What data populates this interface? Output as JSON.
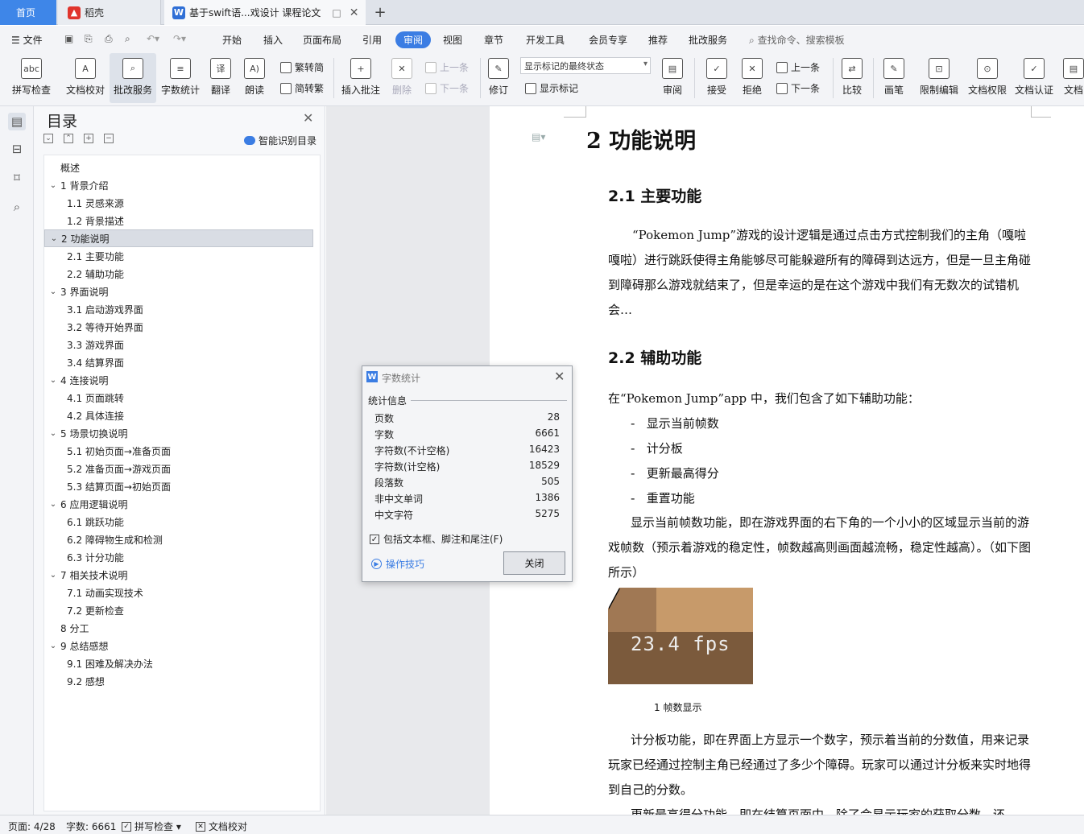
{
  "tabs": {
    "home": "首页",
    "daoke": "稻壳",
    "doc": "基于swift语...戏设计 课程论文",
    "add": "+"
  },
  "menu": {
    "file": "文件",
    "items": [
      "开始",
      "插入",
      "页面布局",
      "引用",
      "审阅",
      "视图",
      "章节",
      "开发工具",
      "会员专享",
      "推荐",
      "批改服务"
    ],
    "active": "审阅",
    "search": "查找命令、搜索模板"
  },
  "ribbon": {
    "spell": "拼写检查",
    "doc_check": "文档校对",
    "correction": "批改服务",
    "word_count": "字数统计",
    "translate": "翻译",
    "read": "朗读",
    "trad": "繁转简",
    "simp": "简转繁",
    "insert_comment": "插入批注",
    "delete": "删除",
    "prev": "上一条",
    "next": "下一条",
    "revise": "修订",
    "markup_state": "显示标记的最终状态",
    "show_markup": "显示标记",
    "review": "审阅",
    "accept": "接受",
    "reject": "拒绝",
    "prev2": "上一条",
    "next2": "下一条",
    "compare": "比较",
    "pen": "画笔",
    "restrict": "限制编辑",
    "permission": "文档权限",
    "certify": "文档认证",
    "more": "文档"
  },
  "toc": {
    "title": "目录",
    "smart": "智能识别目录",
    "items": [
      {
        "label": "概述",
        "level": 0,
        "caret": ""
      },
      {
        "label": "1  背景介绍",
        "level": 0,
        "caret": "v"
      },
      {
        "label": "1.1 灵感来源",
        "level": 1,
        "caret": ""
      },
      {
        "label": "1.2 背景描述",
        "level": 1,
        "caret": ""
      },
      {
        "label": "2 功能说明",
        "level": 0,
        "caret": "v"
      },
      {
        "label": "2.1  主要功能",
        "level": 1,
        "caret": ""
      },
      {
        "label": "2.2 辅助功能",
        "level": 1,
        "caret": ""
      },
      {
        "label": "3  界面说明",
        "level": 0,
        "caret": "v"
      },
      {
        "label": "3.1  启动游戏界面",
        "level": 1,
        "caret": ""
      },
      {
        "label": "3.2  等待开始界面",
        "level": 1,
        "caret": ""
      },
      {
        "label": "3.3  游戏界面",
        "level": 1,
        "caret": ""
      },
      {
        "label": "3.4  结算界面",
        "level": 1,
        "caret": ""
      },
      {
        "label": "4  连接说明",
        "level": 0,
        "caret": "v"
      },
      {
        "label": "4.1  页面跳转",
        "level": 1,
        "caret": ""
      },
      {
        "label": "4.2  具体连接",
        "level": 1,
        "caret": ""
      },
      {
        "label": "5  场景切换说明",
        "level": 0,
        "caret": "v"
      },
      {
        "label": "5.1 初始页面→准备页面",
        "level": 1,
        "caret": ""
      },
      {
        "label": "5.2 准备页面→游戏页面",
        "level": 1,
        "caret": ""
      },
      {
        "label": "5.3 结算页面→初始页面",
        "level": 1,
        "caret": ""
      },
      {
        "label": "6  应用逻辑说明",
        "level": 0,
        "caret": "v"
      },
      {
        "label": "6.1  跳跃功能",
        "level": 1,
        "caret": ""
      },
      {
        "label": "6.2  障碍物生成和检测",
        "level": 1,
        "caret": ""
      },
      {
        "label": "6.3  计分功能",
        "level": 1,
        "caret": ""
      },
      {
        "label": "7 相关技术说明",
        "level": 0,
        "caret": "v"
      },
      {
        "label": "7.1 动画实现技术",
        "level": 1,
        "caret": ""
      },
      {
        "label": "7.2 更新检查",
        "level": 1,
        "caret": ""
      },
      {
        "label": "8  分工",
        "level": 0,
        "caret": ""
      },
      {
        "label": "9  总结感想",
        "level": 0,
        "caret": "v"
      },
      {
        "label": "9.1  困难及解决办法",
        "level": 1,
        "caret": ""
      },
      {
        "label": "9.2  感想",
        "level": 1,
        "caret": ""
      }
    ],
    "selected": "2 功能说明"
  },
  "doc": {
    "h1": "2 功能说明",
    "h2_1": "2.1  主要功能",
    "p1": "“Pokemon Jump”游戏的设计逻辑是通过点击方式控制我们的主角（嘎啦嘎啦）进行跳跃使得主角能够尽可能躲避所有的障碍到达远方，但是一旦主角碰到障碍那么游戏就结束了，但是幸运的是在这个游戏中我们有无数次的试错机会…",
    "h2_2": "2.2 辅助功能",
    "p2": "在“Pokemon Jump”app 中，我们包含了如下辅助功能：",
    "bullets": [
      "显示当前帧数",
      "计分板",
      "更新最高得分",
      "重置功能"
    ],
    "p3": "显示当前帧数功能，即在游戏界面的右下角的一个小小的区域显示当前的游戏帧数（预示着游戏的稳定性，帧数越高则画面越流畅，稳定性越高）。（如下图所示）",
    "fps_text": "23.4 fps",
    "caption": "1 帧数显示",
    "p4": "计分板功能，即在界面上方显示一个数字，预示着当前的分数值，用来记录玩家已经通过控制主角已经通过了多少个障碍。玩家可以通过计分板来实时地得到自己的分数。",
    "p5": "更新最高得分功能，即在结算页面中，除了会显示玩家的获取分数，还"
  },
  "dialog": {
    "title": "字数统计",
    "group": "统计信息",
    "rows": [
      {
        "label": "页数",
        "value": "28"
      },
      {
        "label": "字数",
        "value": "6661"
      },
      {
        "label": "字符数(不计空格)",
        "value": "16423"
      },
      {
        "label": "字符数(计空格)",
        "value": "18529"
      },
      {
        "label": "段落数",
        "value": "505"
      },
      {
        "label": "非中文单词",
        "value": "1386"
      },
      {
        "label": "中文字符",
        "value": "5275"
      }
    ],
    "include": "包括文本框、脚注和尾注(F)",
    "tips": "操作技巧",
    "close": "关闭"
  },
  "status": {
    "page": "页面: 4/28",
    "words": "字数: 6661",
    "spell": "拼写检查",
    "check": "文档校对"
  }
}
